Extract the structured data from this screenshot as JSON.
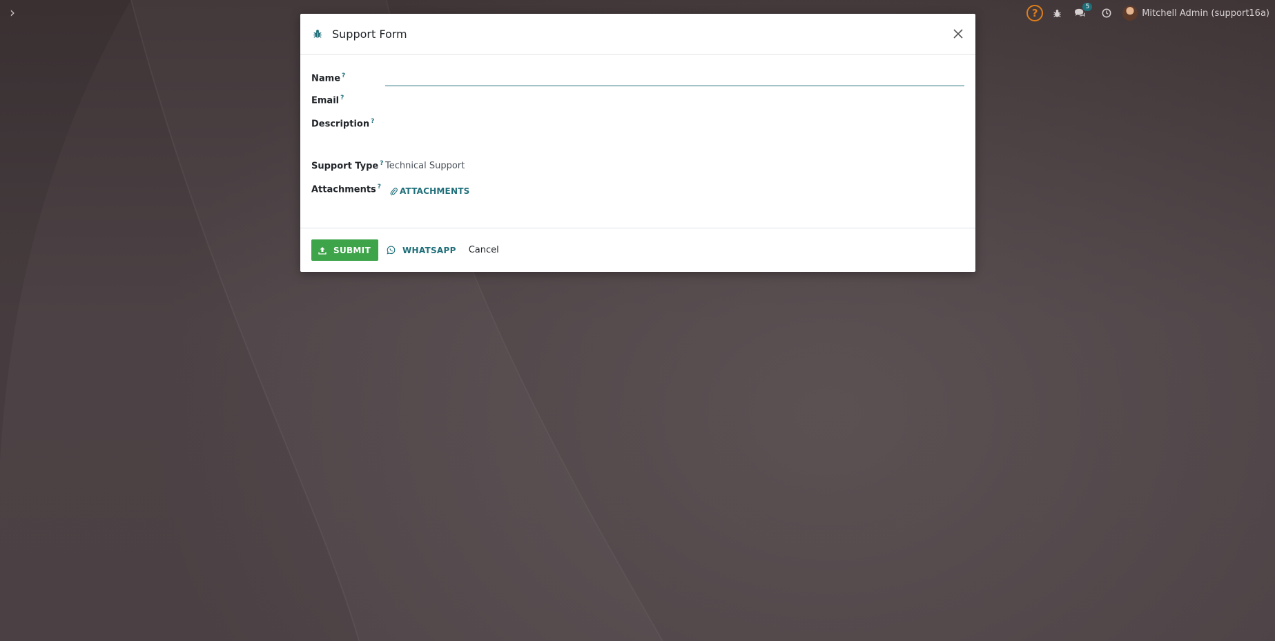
{
  "topbar": {
    "menu_toggle_glyph": "›",
    "help_glyph": "?",
    "bug_icon": "bug-icon",
    "chat_badge": "5",
    "user_name": "Mitchell Admin (support16a)"
  },
  "dialog": {
    "title": "Support Form",
    "fields": {
      "name_label": "Name",
      "name_value": "",
      "email_label": "Email",
      "description_label": "Description",
      "support_type_label": "Support Type",
      "support_type_value": "Technical Support",
      "attachments_label": "Attachments",
      "help_mark": "?"
    },
    "attachments_button": "ATTACHMENTS",
    "footer": {
      "submit_label": "SUBMIT",
      "whatsapp_label": "WHATSAPP",
      "cancel_label": "Cancel"
    }
  },
  "colors": {
    "accent": "#1f6f7a",
    "submit": "#3ea44a",
    "help": "#e07e1a"
  }
}
